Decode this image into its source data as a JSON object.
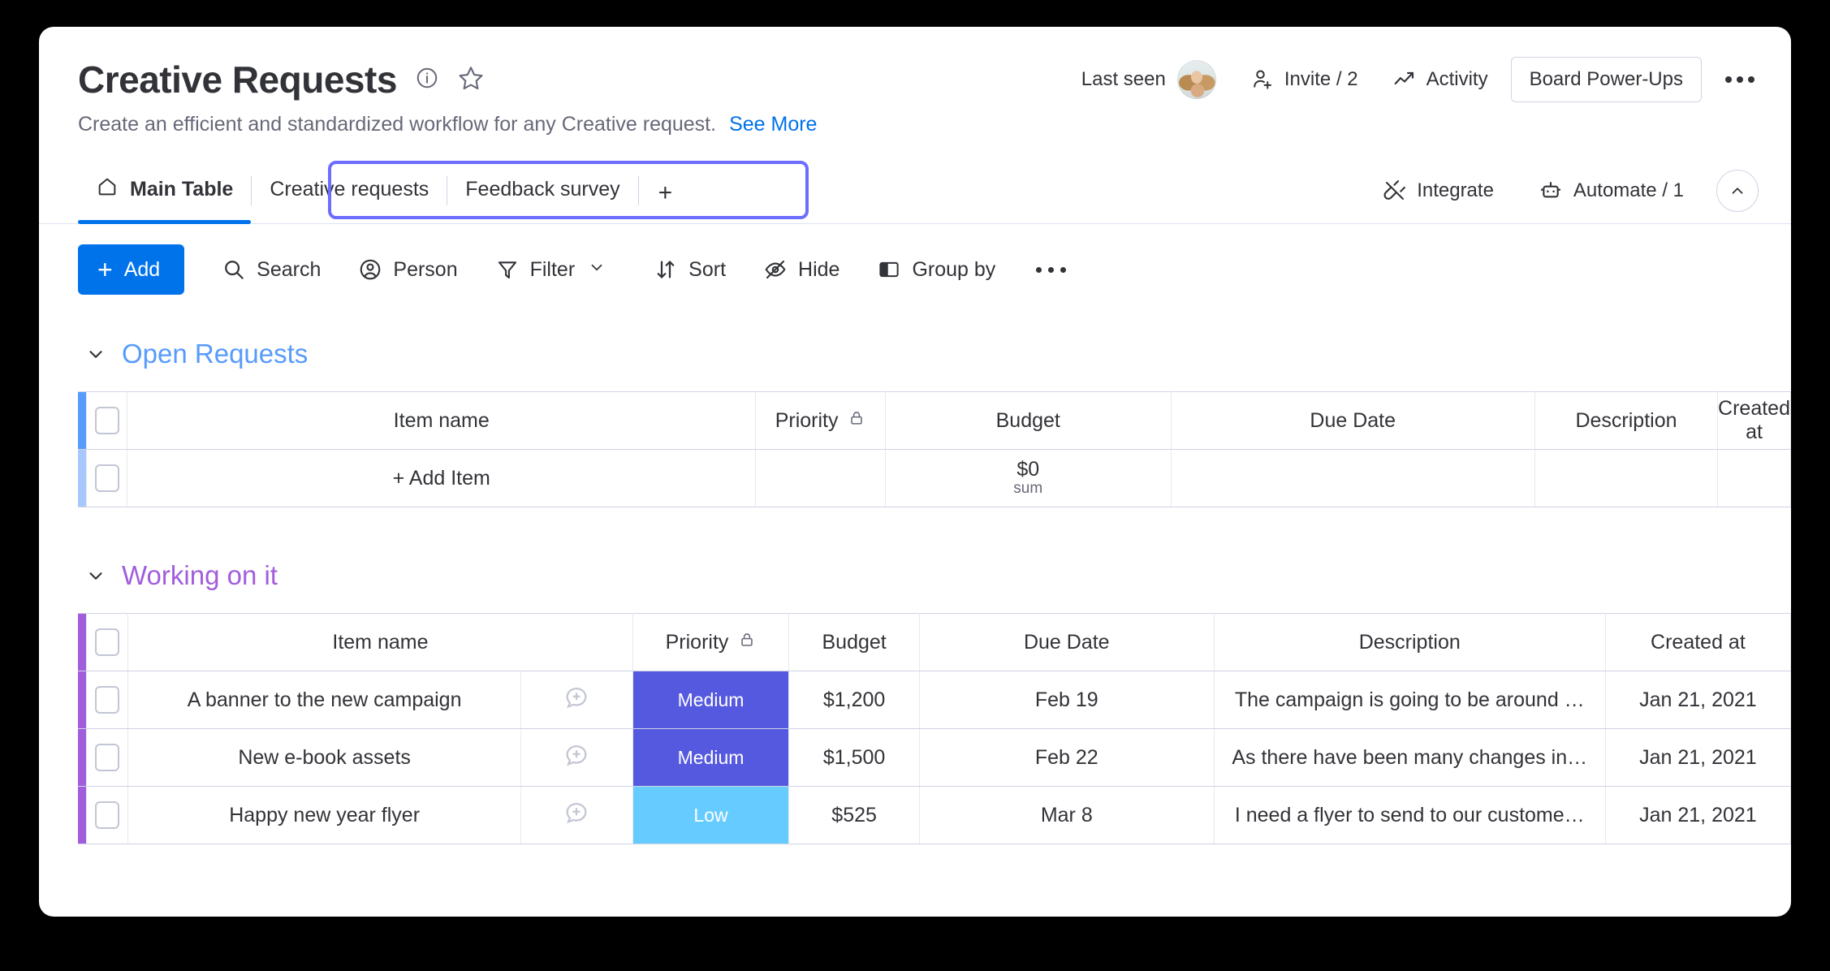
{
  "header": {
    "title": "Creative Requests",
    "subtitle": "Create an efficient and standardized workflow for any Creative request.",
    "see_more": "See More",
    "last_seen_label": "Last seen",
    "invite_label": "Invite / 2",
    "activity_label": "Activity",
    "power_ups_label": "Board Power-Ups"
  },
  "tabs": {
    "main": "Main Table",
    "items": [
      "Creative requests",
      "Feedback survey"
    ],
    "add": "+",
    "integrate_label": "Integrate",
    "automate_label": "Automate / 1"
  },
  "toolbar": {
    "add_label": "Add",
    "search_label": "Search",
    "person_label": "Person",
    "filter_label": "Filter",
    "sort_label": "Sort",
    "hide_label": "Hide",
    "group_by_label": "Group by"
  },
  "columns": [
    "Item name",
    "Priority",
    "Budget",
    "Due Date",
    "Description",
    "Created at"
  ],
  "groups": [
    {
      "name": "Open Requests",
      "color": "#579bfc",
      "color_light": "#a8c8fd",
      "add_item_label": "+ Add Item",
      "budget_sum": "$0",
      "budget_sum_label": "sum",
      "rows": []
    },
    {
      "name": "Working on it",
      "color": "#a25ddc",
      "color_light": "#a25ddc",
      "rows": [
        {
          "name": "A banner to the new campaign",
          "priority": "Medium",
          "priority_color": "#5559df",
          "budget": "$1,200",
          "due_date": "Feb 19",
          "description": "The campaign is going to be around …",
          "created_at": "Jan 21, 2021"
        },
        {
          "name": "New e-book assets",
          "priority": "Medium",
          "priority_color": "#5559df",
          "budget": "$1,500",
          "due_date": "Feb 22",
          "description": "As there have been many changes in…",
          "created_at": "Jan 21, 2021"
        },
        {
          "name": "Happy new year flyer",
          "priority": "Low",
          "priority_color": "#66ccff",
          "budget": "$525",
          "due_date": "Mar 8",
          "description": "I need a flyer to send to our custome…",
          "created_at": "Jan 21, 2021"
        }
      ]
    }
  ],
  "colors": {
    "accent": "#0073ea",
    "tab_highlight": "#6c6cff",
    "text": "#323338",
    "muted": "#676879"
  }
}
